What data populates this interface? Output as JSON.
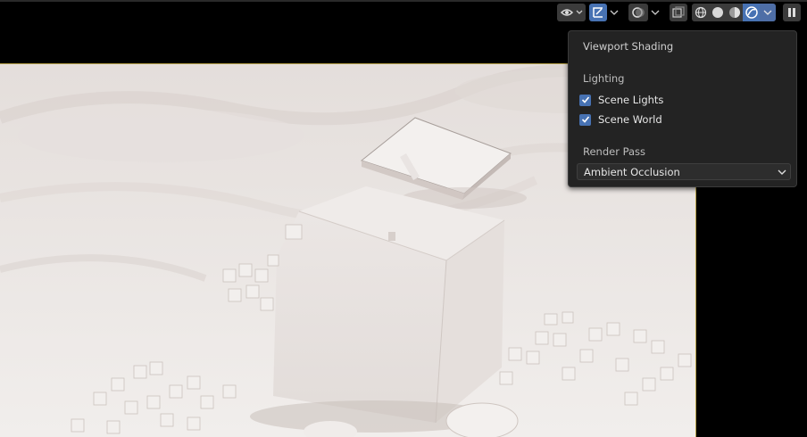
{
  "popover": {
    "title": "Viewport Shading",
    "lighting_label": "Lighting",
    "scene_lights_label": "Scene Lights",
    "scene_lights_checked": true,
    "scene_world_label": "Scene World",
    "scene_world_checked": true,
    "render_pass_label": "Render Pass",
    "render_pass_value": "Ambient Occlusion"
  },
  "toolbar": {
    "icons": [
      "visibility-icon",
      "gizmo-icon",
      "overlay-icon",
      "xray-icon",
      "wireframe-shading-icon",
      "solid-shading-icon",
      "material-shading-icon",
      "rendered-shading-icon",
      "shading-options-dropdown",
      "pause-icon"
    ],
    "active_shading": "rendered",
    "accent_color": "#4772b3"
  },
  "viewport": {
    "scene": "ambient-occlusion render of buildings on terrain"
  }
}
